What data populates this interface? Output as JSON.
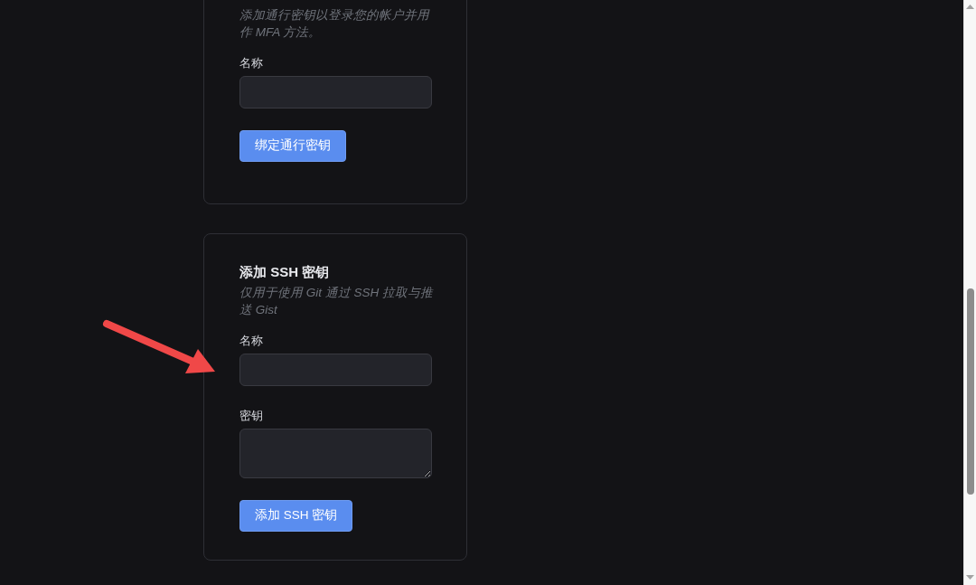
{
  "cards": [
    {
      "description": "添加通行密钥以登录您的帐户并用作 MFA 方法。",
      "fields": [
        {
          "kind": "input",
          "label": "名称"
        }
      ],
      "button": "绑定通行密钥"
    },
    {
      "title": "添加 SSH 密钥",
      "description": "仅用于使用 Git 通过 SSH 拉取与推送 Gist",
      "fields": [
        {
          "kind": "input",
          "label": "名称"
        },
        {
          "kind": "textarea",
          "label": "密钥"
        }
      ],
      "button": "添加 SSH 密钥"
    }
  ]
}
